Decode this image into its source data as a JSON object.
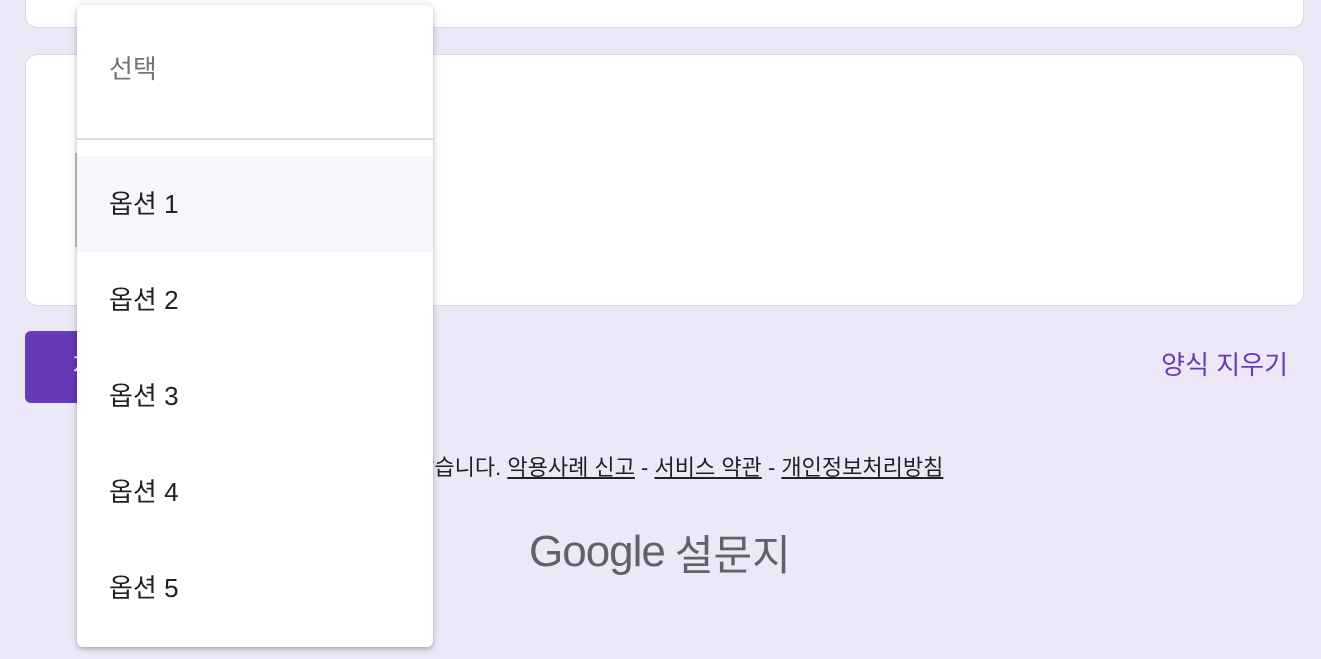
{
  "form": {
    "submit_label": "제출",
    "clear_label": "양식 지우기"
  },
  "footer": {
    "disclaimer_text": "들거나 승인하지 않았습니다.",
    "links": [
      "악용사례 신고",
      "서비스 약관",
      "개인정보처리방침"
    ],
    "separator": "-"
  },
  "brand": {
    "google": "Google",
    "product": "설문지"
  },
  "dropdown": {
    "placeholder": "선택",
    "options": [
      "옵션 1",
      "옵션 2",
      "옵션 3",
      "옵션 4",
      "옵션 5"
    ],
    "highlighted_index": 0
  },
  "colors": {
    "background": "#ede8f7",
    "accent": "#673ab7"
  }
}
